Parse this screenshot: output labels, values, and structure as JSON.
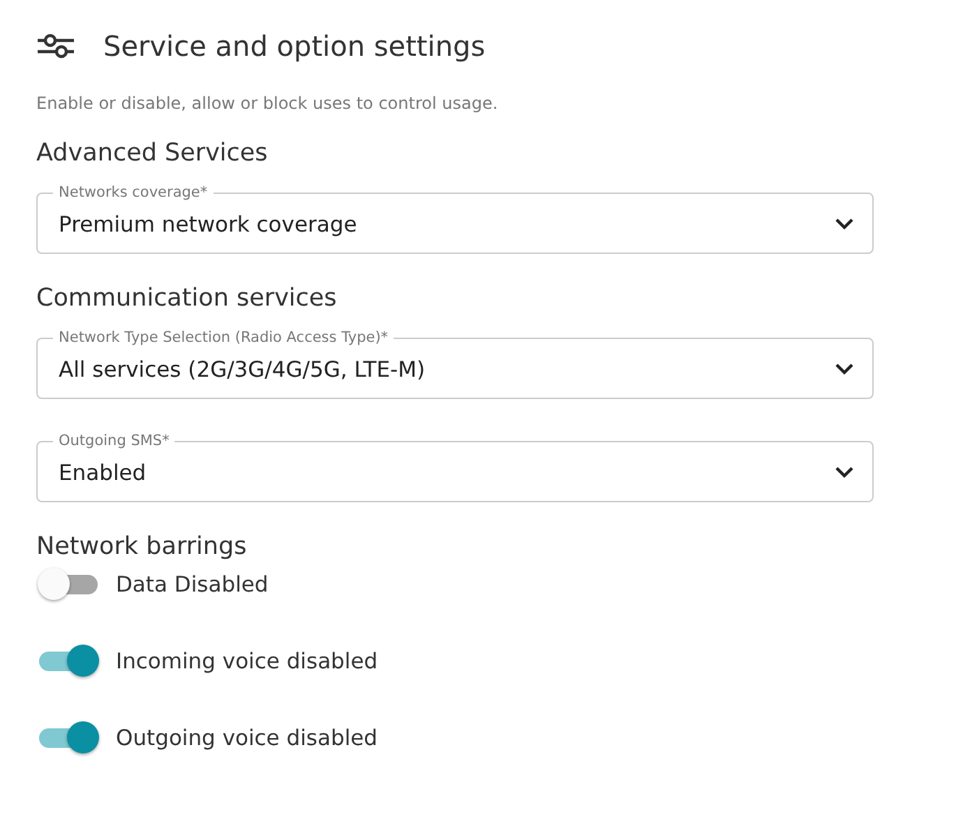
{
  "title": "Service and option settings",
  "description": "Enable or disable, allow or block uses to control usage.",
  "sections": [
    {
      "kind": "selects",
      "heading": "Advanced Services",
      "fields": [
        {
          "label": "Networks coverage*",
          "value": "Premium network coverage"
        }
      ]
    },
    {
      "kind": "selects",
      "heading": "Communication services",
      "fields": [
        {
          "label": "Network Type Selection (Radio Access Type)*",
          "value": "All services (2G/3G/4G/5G, LTE-M)"
        },
        {
          "label": "Outgoing SMS*",
          "value": "Enabled"
        }
      ]
    },
    {
      "kind": "toggles",
      "heading": "Network barrings",
      "toggles": [
        {
          "label": "Data Disabled",
          "on": false
        },
        {
          "label": "Incoming voice disabled",
          "on": true
        },
        {
          "label": "Outgoing voice disabled",
          "on": true
        }
      ]
    }
  ]
}
